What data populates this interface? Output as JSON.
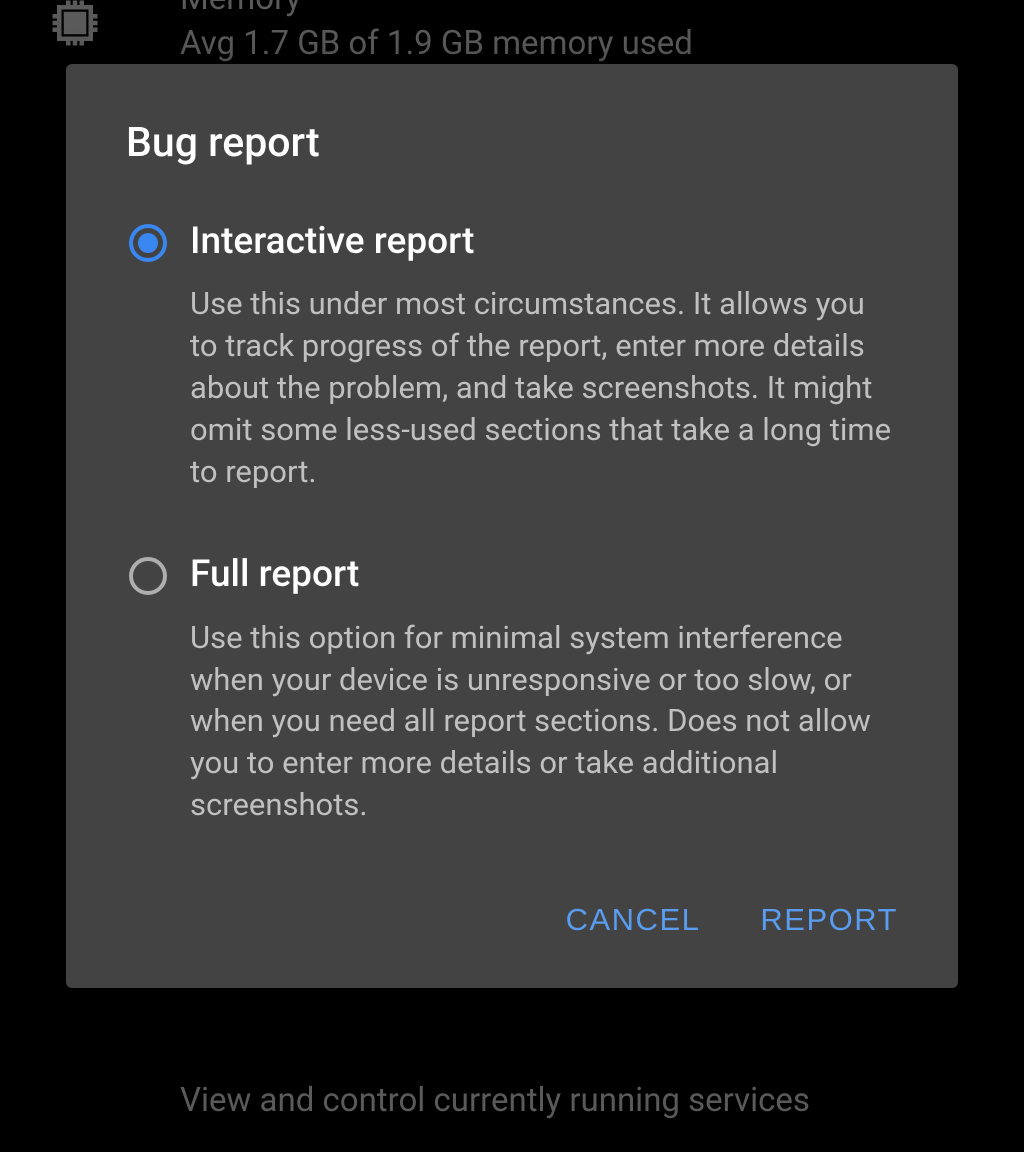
{
  "background": {
    "memory_title": "Memory",
    "memory_sub": "Avg 1.7 GB of 1.9 GB memory used",
    "bottom_text": "View and control currently running services"
  },
  "dialog": {
    "title": "Bug report",
    "option1": {
      "label": "Interactive report",
      "desc": "Use this under most circumstances. It allows you to track progress of the report, enter more details about the problem, and take screenshots. It might omit some less-used sections that take a long time to report."
    },
    "option2": {
      "label": "Full report",
      "desc": "Use this option for minimal system interference when your device is unresponsive or too slow, or when you need all report sections. Does not allow you to enter more details or take additional screenshots."
    },
    "cancel": "CANCEL",
    "report": "REPORT"
  }
}
